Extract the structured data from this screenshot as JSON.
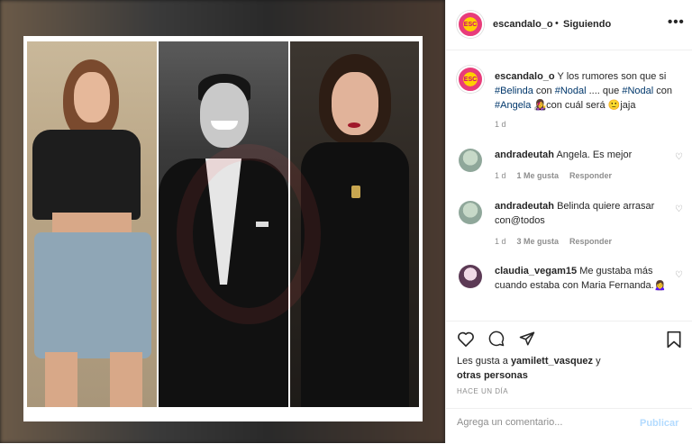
{
  "header": {
    "username": "escandalo_o",
    "separator": "•",
    "follow_status": "Siguiendo",
    "more": "•••",
    "avatar_text": "ESC"
  },
  "caption": {
    "username": "escandalo_o",
    "text_1": "Y los rumores son que si",
    "tag_1": "#Belinda",
    "text_2": "con",
    "tag_2": "#Nodal",
    "text_3": ".... que",
    "tag_3": "#Nodal",
    "text_4": "con",
    "tag_4": "#Angela",
    "emoji_1": "👩‍🎤",
    "text_5": "con cuál será",
    "emoji_2": "🙂",
    "text_6": "jaja",
    "age": "1 d"
  },
  "comments": [
    {
      "username": "andradeutah",
      "text": "Angela. Es mejor",
      "age": "1 d",
      "likes": "1 Me gusta",
      "reply": "Responder"
    },
    {
      "username": "andradeutah",
      "text": "Belinda quiere arrasar con@todos",
      "age": "1 d",
      "likes": "3 Me gusta",
      "reply": "Responder"
    },
    {
      "username": "claudia_vegam15",
      "text": "Me gustaba más cuando estaba con Maria Fernanda.",
      "emoji": "🙍‍♀️"
    }
  ],
  "actions": {
    "like_icon": "heart-icon",
    "comment_icon": "comment-icon",
    "share_icon": "share-icon",
    "save_icon": "bookmark-icon"
  },
  "likes": {
    "prefix": "Les gusta a",
    "user": "yamilett_vasquez",
    "and": "y",
    "others": "otras personas"
  },
  "timestamp": "HACE UN DÍA",
  "add_comment": {
    "placeholder": "Agrega un comentario...",
    "publish": "Publicar"
  },
  "colors": {
    "link": "#00376b",
    "muted": "#8e8e8e",
    "publish_disabled": "#b3dbff"
  }
}
